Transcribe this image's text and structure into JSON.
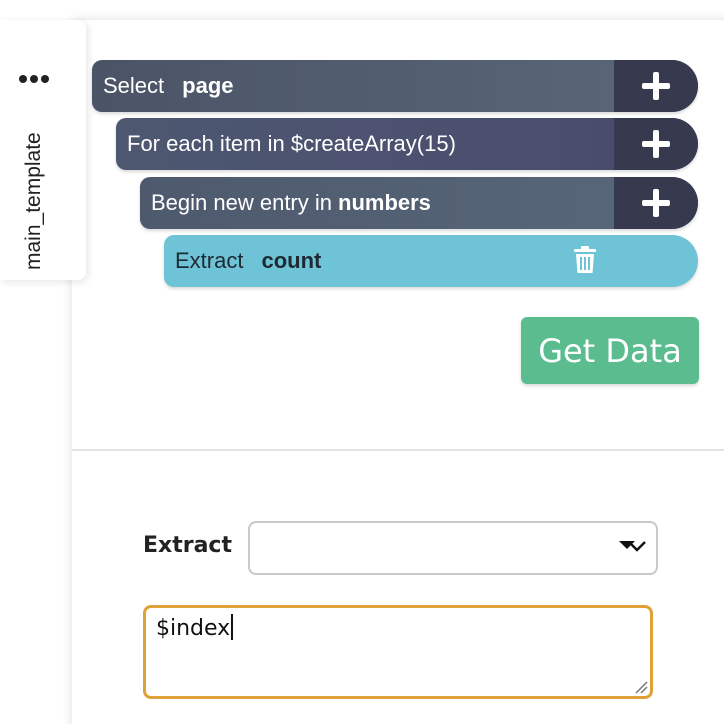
{
  "sidebar": {
    "tab_label": "main_template",
    "menu_icon": "ellipsis-icon"
  },
  "commands": [
    {
      "prefix": "Select",
      "keyword": "page",
      "action_icon": "plus-icon",
      "color": "#4b5466"
    },
    {
      "prefix": "For each item in $createArray(15)",
      "keyword": "",
      "action_icon": "plus-icon",
      "color": "#4d5870"
    },
    {
      "prefix": "Begin new entry in",
      "keyword": "numbers",
      "action_icon": "plus-icon",
      "color": "#4e596d"
    },
    {
      "prefix": "Extract",
      "keyword": "count",
      "action_icon": "trash-icon",
      "color": "#6ec4d6"
    }
  ],
  "get_data_button": {
    "label": "Get Data",
    "color": "#5bbd8f"
  },
  "editor": {
    "extract_label": "Extract",
    "select_value": "",
    "textarea_value": "$index",
    "focus_color": "#e0a137"
  }
}
